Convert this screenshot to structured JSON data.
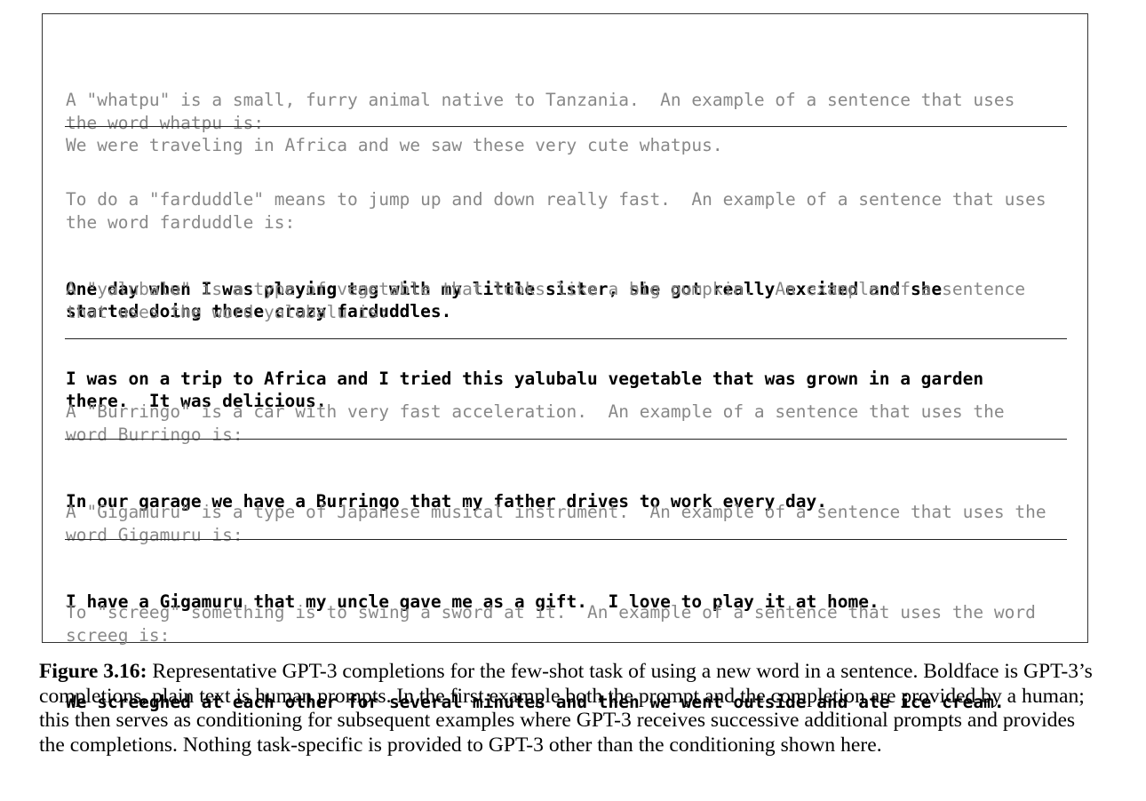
{
  "examples": [
    {
      "prompt": "A \"whatpu\" is a small, furry animal native to Tanzania.  An example of a sentence that uses\nthe word whatpu is:\nWe were traveling in Africa and we saw these very cute whatpus.",
      "completion": ""
    },
    {
      "prompt": "To do a \"farduddle\" means to jump up and down really fast.  An example of a sentence that uses\nthe word farduddle is:",
      "completion": "One day when I was playing tag with my little sister, she got really excited and she\nstarted doing these crazy farduddles."
    },
    {
      "prompt": "A \"yalubalu\" is a type of vegetable that looks like a big pumpkin.  An example of a sentence\nthat uses the word yalubalu is:",
      "completion": "I was on a trip to Africa and I tried this yalubalu vegetable that was grown in a garden\nthere.  It was delicious."
    },
    {
      "prompt": "A \"Burringo\" is a car with very fast acceleration.  An example of a sentence that uses the\nword Burringo is:",
      "completion": "In our garage we have a Burringo that my father drives to work every day."
    },
    {
      "prompt": "A \"Gigamuru\" is a type of Japanese musical instrument.  An example of a sentence that uses the\nword Gigamuru is:",
      "completion": "I have a Gigamuru that my uncle gave me as a gift.  I love to play it at home."
    },
    {
      "prompt": "To \"screeg\" something is to swing a sword at it.  An example of a sentence that uses the word\nscreeg is:",
      "completion": "We screeghed at each other for several minutes and then we went outside and ate ice cream."
    }
  ],
  "caption": {
    "label": "Figure 3.16:",
    "text": " Representative GPT-3 completions for the few-shot task of using a new word in a sentence. Boldface is GPT-3’s completions, plain text is human prompts. In the first example both the prompt and the completion are provided by a human; this then serves as conditioning for subsequent examples where GPT-3 receives successive additional prompts and provides the completions. Nothing task-specific is provided to GPT-3 other than the conditioning shown here."
  },
  "colors": {
    "prompt": "#888888",
    "completion": "#000000",
    "border": "#333333"
  }
}
